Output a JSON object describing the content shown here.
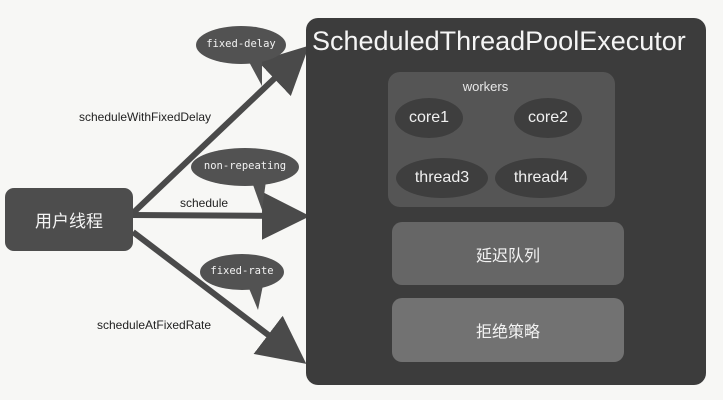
{
  "diagram": {
    "user_thread": "用户线程",
    "executor_title": "ScheduledThreadPoolExecutor",
    "workers_label": "workers",
    "workers": [
      "core1",
      "core2",
      "thread3",
      "thread4"
    ],
    "delay_queue": "延迟队列",
    "reject_policy": "拒绝策略",
    "arrows": {
      "top": {
        "method": "scheduleWithFixedDelay",
        "bubble": "fixed-delay"
      },
      "middle": {
        "method": "schedule",
        "bubble": "non-repeating"
      },
      "bottom": {
        "method": "scheduleAtFixedRate",
        "bubble": "fixed-rate"
      }
    }
  },
  "colors": {
    "dark": "#3c3c3c",
    "box": "#4d4d4d",
    "arrow": "#4a4a4a",
    "bubble": "#525252"
  }
}
